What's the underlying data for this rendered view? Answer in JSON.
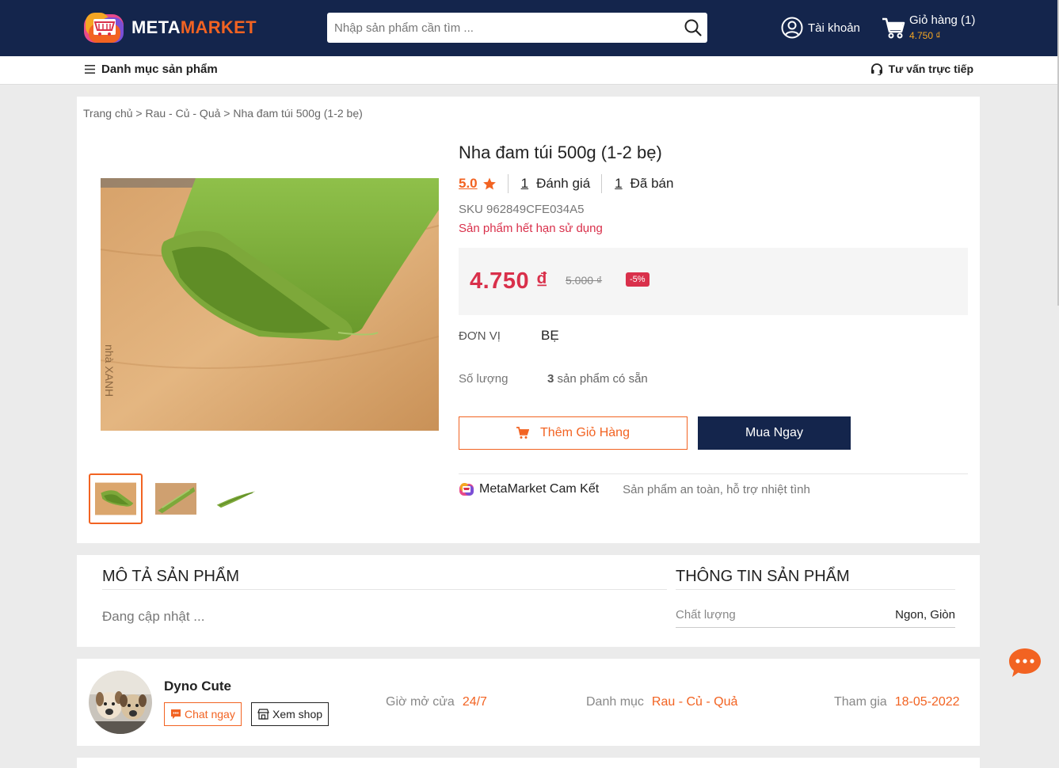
{
  "header": {
    "brand_part1": "META",
    "brand_part2": "MARKET",
    "search_placeholder": "Nhập sản phẩm cần tìm ...",
    "account_label": "Tài khoản",
    "cart_label": "Giỏ hàng (1)",
    "cart_total": "4.750 ₫"
  },
  "navbar": {
    "categories_label": "Danh mục sản phẩm",
    "consult_label": "Tư vấn trực tiếp"
  },
  "breadcrumb": "Trang chủ > Rau - Củ - Quả > Nha đam túi 500g (1-2 bẹ)",
  "product": {
    "title": "Nha đam túi 500g (1-2 bẹ)",
    "rating": "5.0",
    "reviews_count": "1",
    "reviews_label": "Đánh giá",
    "sold_count": "1",
    "sold_label": "Đã bán",
    "sku": "SKU 962849CFE034A5",
    "expired_notice": "Sản phẩm hết hạn sử dụng",
    "price": "4.750 ₫",
    "old_price": "5.000 ₫",
    "discount": "-5%",
    "unit_label": "ĐƠN VỊ",
    "unit_value": "BẸ",
    "quantity_label": "Số lượng",
    "stock_number": "3",
    "stock_text": "sản phẩm có sẵn",
    "add_to_cart": "Thêm Giỏ Hàng",
    "buy_now": "Mua Ngay",
    "commit_title": "MetaMarket Cam Kết",
    "commit_desc": "Sản phẩm an toàn, hỗ trợ nhiệt tình"
  },
  "description": {
    "title": "MÔ TẢ SẢN PHẨM",
    "text": "Đang cập nhật ...",
    "info_title": "THÔNG TIN SẢN PHẨM",
    "quality_label": "Chất lượng",
    "quality_value": "Ngon, Giòn"
  },
  "shop": {
    "name": "Dyno Cute",
    "chat_label": "Chat ngay",
    "view_shop_label": "Xem shop",
    "hours_label": "Giờ mở cửa",
    "hours_value": "24/7",
    "category_label": "Danh mục",
    "category_value": "Rau - Củ - Quả",
    "joined_label": "Tham gia",
    "joined_value": "18-05-2022"
  },
  "colors": {
    "header_bg": "#14254c",
    "accent_orange": "#f26322",
    "price_red": "#d9304b"
  },
  "icons": [
    "logo-icon",
    "search-icon",
    "user-icon",
    "cart-icon",
    "menu-icon",
    "headset-icon",
    "star-icon",
    "cart-add-icon",
    "chat-icon",
    "shop-icon",
    "chat-bubble-icon"
  ]
}
